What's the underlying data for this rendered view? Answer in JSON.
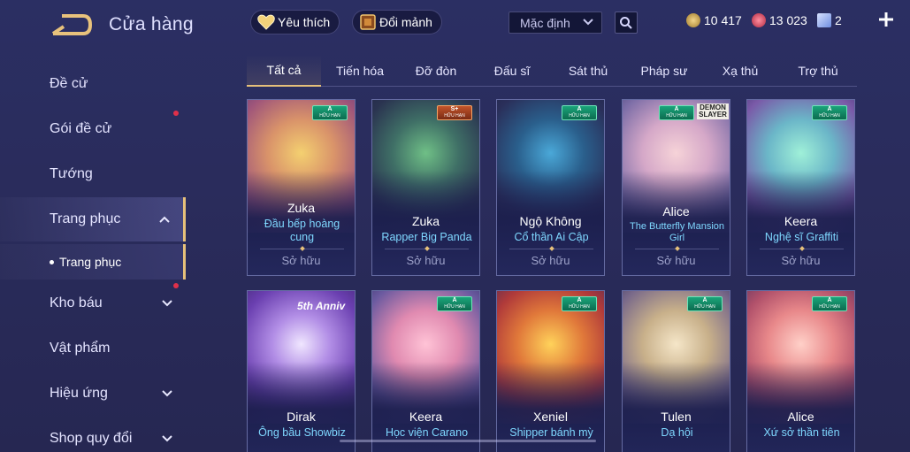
{
  "header": {
    "title": "Cửa hàng",
    "favorite_label": "Yêu thích",
    "exchange_label": "Đổi mảnh",
    "sort_value": "Mặc định",
    "currencies": [
      {
        "value": "10 417",
        "color": "#c9a24a",
        "icon": "gold-coin-icon"
      },
      {
        "value": "13 023",
        "color": "#d6455c",
        "icon": "ruby-icon"
      },
      {
        "value": "2",
        "color": "#9ab6ff",
        "icon": "voucher-icon"
      }
    ]
  },
  "sidebar": {
    "items": [
      {
        "label": "Đề cử"
      },
      {
        "label": "Gói đề cử"
      },
      {
        "label": "Tướng"
      },
      {
        "label": "Trang phục"
      },
      {
        "label": "Kho báu"
      },
      {
        "label": "Vật phẩm"
      },
      {
        "label": "Hiệu ứng"
      },
      {
        "label": "Shop quy đổi"
      }
    ],
    "sub_item": "Trang phục"
  },
  "tabs": [
    "Tất cả",
    "Tiến hóa",
    "Đỡ đòn",
    "Đấu sĩ",
    "Sát thủ",
    "Pháp sư",
    "Xạ thủ",
    "Trợ thủ"
  ],
  "cards": [
    {
      "hero": "Zuka",
      "skin": "Đầu bếp hoàng cung",
      "status": "Sở hữu",
      "grade": "A",
      "limited": "HỮU HẠN"
    },
    {
      "hero": "Zuka",
      "skin": "Rapper Big Panda",
      "status": "Sở hữu",
      "grade": "S+",
      "limited": "HỮU HẠN"
    },
    {
      "hero": "Ngộ Không",
      "skin": "Cổ thần Ai Cập",
      "status": "Sở hữu",
      "grade": "A",
      "limited": "HỮU HẠN"
    },
    {
      "hero": "Alice",
      "skin": "The Butterfly Mansion Girl",
      "status": "Sở hữu",
      "grade": "A",
      "limited": "HỮU HẠN",
      "art_text": "DEMON SLAYER"
    },
    {
      "hero": "Keera",
      "skin": "Nghệ sĩ Graffiti",
      "status": "Sở hữu",
      "grade": "A",
      "limited": "HỮU HẠN"
    },
    {
      "hero": "Dirak",
      "skin": "Ông bầu Showbiz",
      "grade": "A",
      "limited": "HỮU HẠN",
      "art_text": "5th Anniv"
    },
    {
      "hero": "Keera",
      "skin": "Học viện Carano",
      "grade": "A",
      "limited": "HỮU HẠN"
    },
    {
      "hero": "Xeniel",
      "skin": "Shipper bánh mỳ",
      "grade": "A",
      "limited": "HỮU HẠN"
    },
    {
      "hero": "Tulen",
      "skin": "Dạ hội",
      "grade": "A",
      "limited": "HỮU HẠN"
    },
    {
      "hero": "Alice",
      "skin": "Xứ sở thần tiên",
      "grade": "A",
      "limited": "HỮU HẠN"
    }
  ]
}
